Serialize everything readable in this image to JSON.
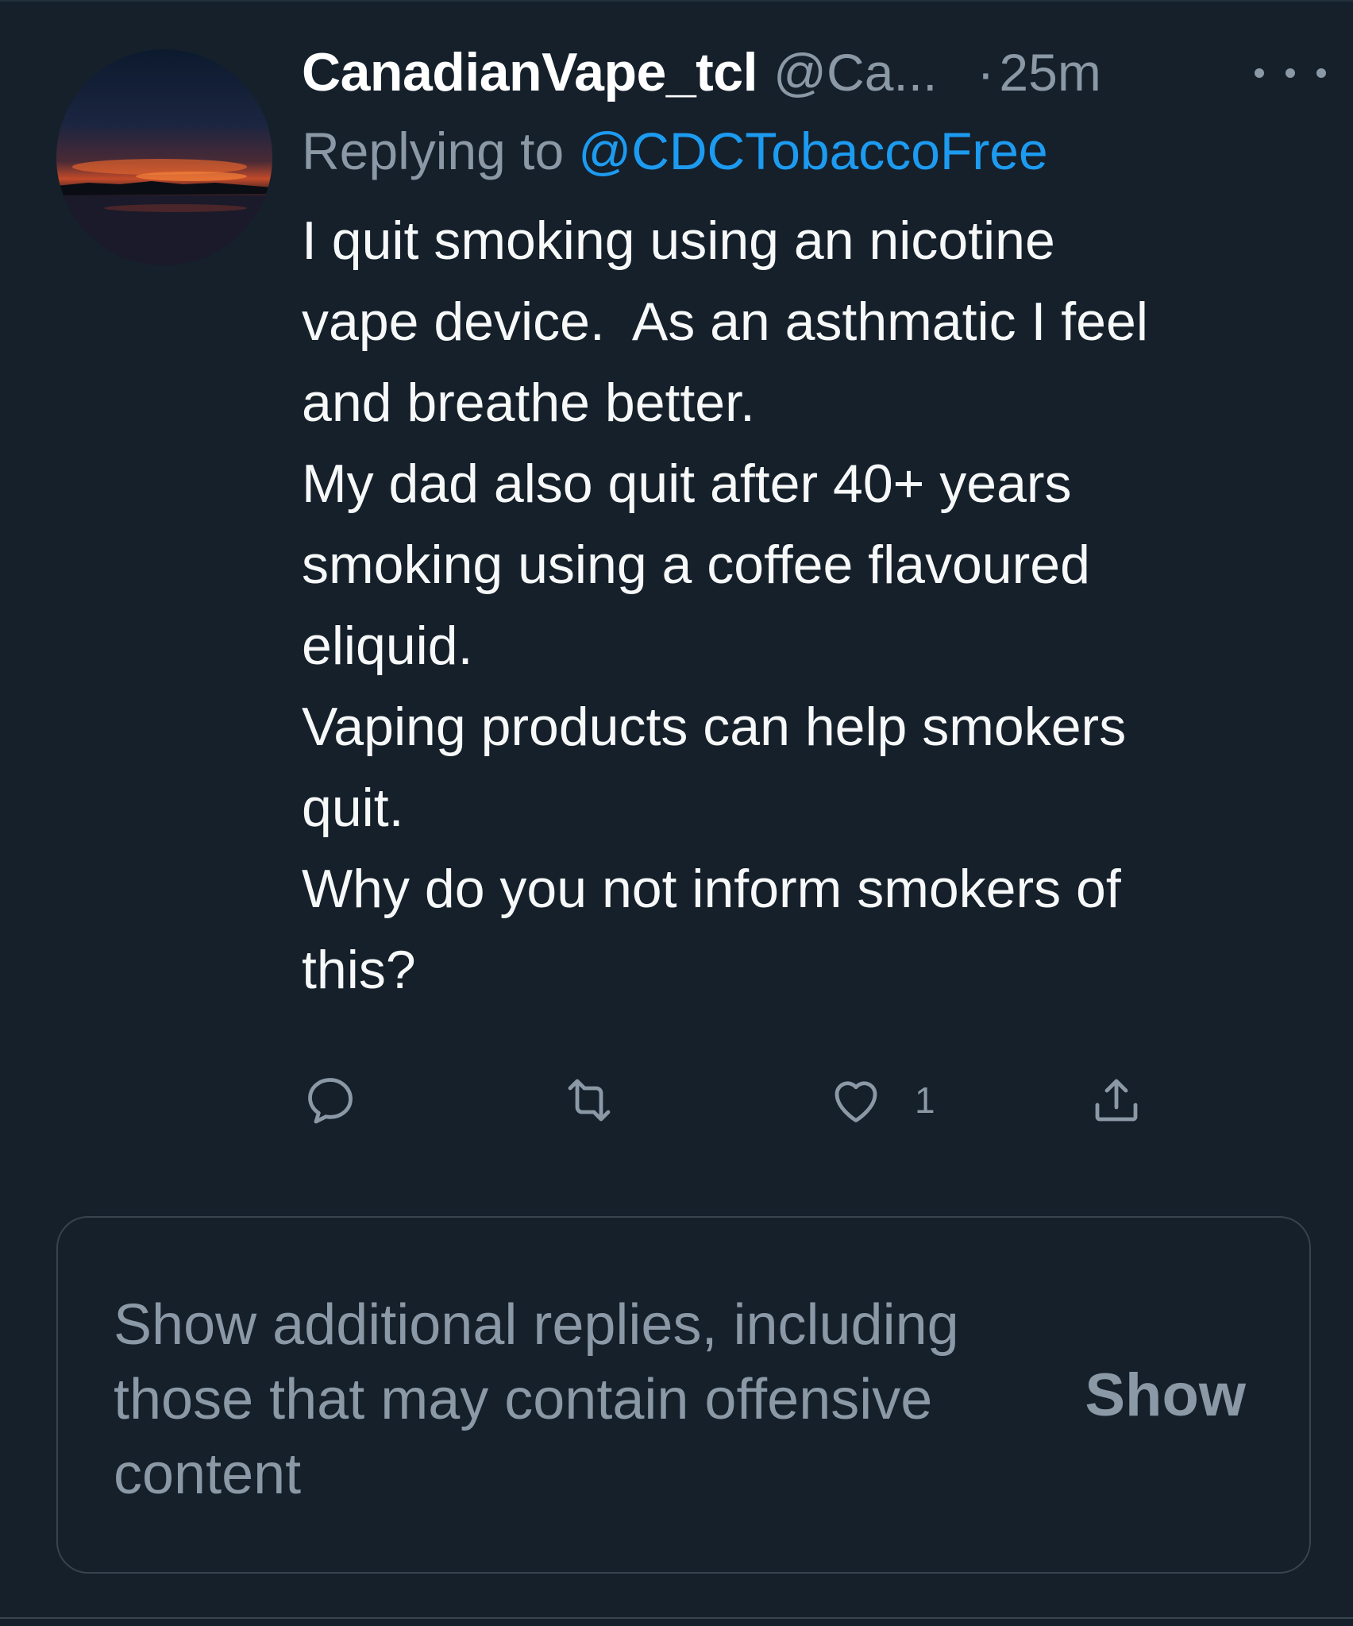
{
  "tweet": {
    "display_name": "CanadianVape_tcl",
    "handle": "@Ca...",
    "separator": "·",
    "time": "25m",
    "reply_prefix": "Replying to",
    "reply_to": "@CDCTobaccoFree",
    "text": "I quit smoking using an nicotine\nvape device.  As an asthmatic I feel\nand breathe better.\nMy dad also quit after 40+ years\nsmoking using a coffee flavoured\neliquid.\nVaping products can help smokers\nquit.\nWhy do you not inform smokers of\nthis?",
    "like_count": "1"
  },
  "icons": {
    "reply": "reply-icon",
    "retweet": "retweet-icon",
    "like": "heart-icon",
    "share": "share-icon",
    "more": "more-icon"
  },
  "additional_replies": {
    "text": "Show additional replies, including those that may contain offensive content",
    "show_label": "Show"
  },
  "colors": {
    "background": "#15202b",
    "text": "#f7f9f9",
    "secondary": "#8b98a5",
    "accent": "#1d9bf0",
    "border": "#38444d"
  }
}
